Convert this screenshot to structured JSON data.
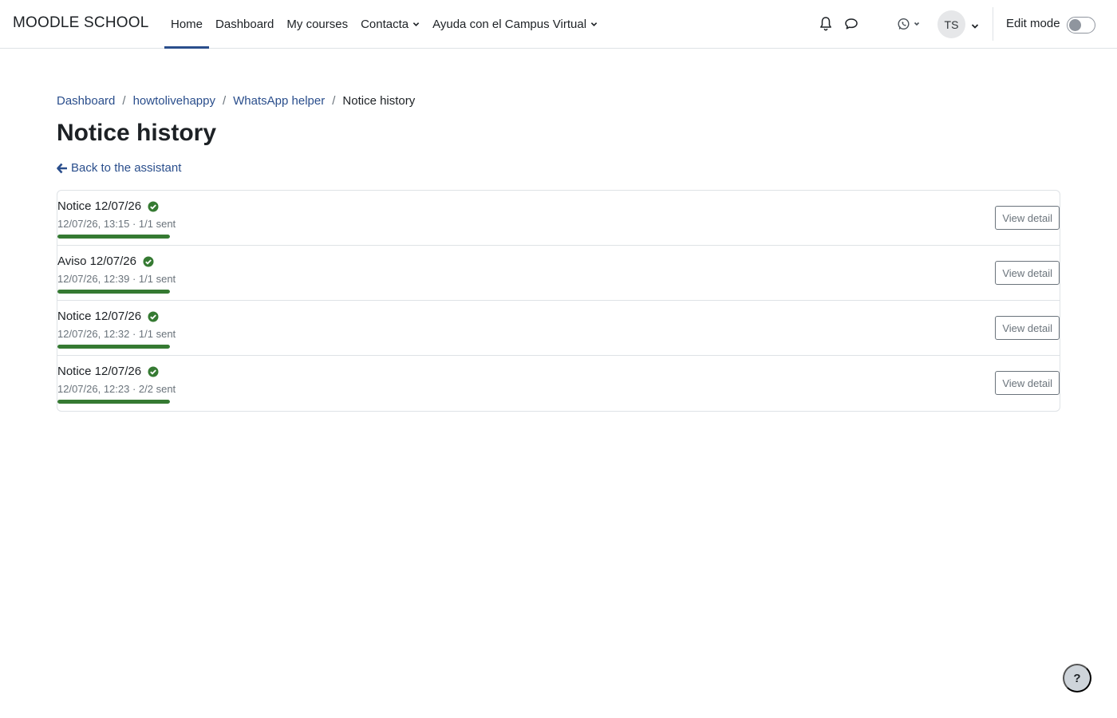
{
  "site": {
    "brand": "MOODLE SCHOOL"
  },
  "nav": {
    "items": [
      {
        "label": "Home",
        "active": true,
        "dropdown": false
      },
      {
        "label": "Dashboard",
        "active": false,
        "dropdown": false
      },
      {
        "label": "My courses",
        "active": false,
        "dropdown": false
      },
      {
        "label": "Contacta",
        "active": false,
        "dropdown": true
      },
      {
        "label": "Ayuda con el Campus Virtual",
        "active": false,
        "dropdown": true
      }
    ]
  },
  "user": {
    "initials": "TS",
    "edit_mode_label": "Edit mode",
    "edit_mode_on": false
  },
  "icons": {
    "notifications": "bell-icon",
    "messages": "chat-bubble-icon",
    "whatsapp": "whatsapp-icon",
    "back": "arrow-left-icon",
    "status": "check-circle-icon"
  },
  "colors": {
    "link": "#2a4e8c",
    "success": "#357a32",
    "border": "#dee2e6",
    "muted": "#6a737b"
  },
  "breadcrumb": {
    "items": [
      "Dashboard",
      "howtolivehappy",
      "WhatsApp helper"
    ],
    "current": "Notice history"
  },
  "page": {
    "title": "Notice history",
    "back_label": "Back to the assistant"
  },
  "notices": [
    {
      "title": "Notice 12/07/26",
      "meta": "12/07/26, 13:15 · 1/1 sent",
      "progress": 1.0,
      "button": "View detail"
    },
    {
      "title": "Aviso 12/07/26",
      "meta": "12/07/26, 12:39 · 1/1 sent",
      "progress": 1.0,
      "button": "View detail"
    },
    {
      "title": "Notice 12/07/26",
      "meta": "12/07/26, 12:32 · 1/1 sent",
      "progress": 1.0,
      "button": "View detail"
    },
    {
      "title": "Notice 12/07/26",
      "meta": "12/07/26, 12:23 · 2/2 sent",
      "progress": 1.0,
      "button": "View detail"
    }
  ],
  "help": {
    "label": "?"
  }
}
